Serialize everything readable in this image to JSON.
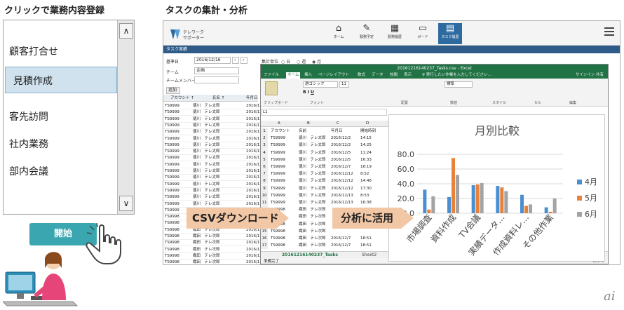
{
  "left": {
    "heading": "クリックで業務内容登録",
    "tasks": [
      "顧客打合せ",
      "見積作成",
      "客先訪問",
      "社内業務",
      "部内会議"
    ],
    "selected_index": 1,
    "scroll_up": "∧",
    "scroll_down": "∨",
    "start_button": "開始"
  },
  "right": {
    "heading": "タスクの集計・分析"
  },
  "app": {
    "logo_text": "テレワーク\nサポーター",
    "nav": [
      {
        "label": "ホーム",
        "icon": "home-icon"
      },
      {
        "label": "勤務予定",
        "icon": "edit-icon"
      },
      {
        "label": "勤務履歴",
        "icon": "calendar-icon"
      },
      {
        "label": "ボード",
        "icon": "monitor-icon"
      },
      {
        "label": "タスク履歴",
        "icon": "task-history-icon"
      }
    ],
    "subbar_title": "タスク実績",
    "filters": {
      "base_date_label": "基準日",
      "base_date_value": "2016/12/16",
      "period_label": "集計単位",
      "period_options": [
        "日",
        "週",
        "月"
      ],
      "team_label": "チーム",
      "team_value": "企画",
      "member_label": "チームメンバー",
      "add_button": "追加"
    },
    "list_headers": [
      "アカウント ↑",
      "氏名 ↑",
      "年月日"
    ],
    "list_rows": [
      [
        "TS9999",
        "徳川　テレ太郎",
        "2016/12"
      ],
      [
        "TS9999",
        "徳川　テレ太郎",
        "2016/12"
      ],
      [
        "TS9999",
        "徳川　テレ太郎",
        "2016/12"
      ],
      [
        "TS9999",
        "徳川　テレ太郎",
        "2016/12"
      ],
      [
        "TS9999",
        "徳川　テレ太郎",
        "2016/12"
      ],
      [
        "TS9999",
        "徳川　テレ太郎",
        "2016/12"
      ],
      [
        "TS9999",
        "徳川　テレ太郎",
        "2016/12"
      ],
      [
        "TS9999",
        "徳川　テレ太郎",
        "2016/12"
      ],
      [
        "TS9999",
        "徳川　テレ太郎",
        "2016/12"
      ],
      [
        "TS9999",
        "徳川　テレ太郎",
        "2016/12"
      ],
      [
        "TS9999",
        "徳川　テレ太郎",
        "2016/12"
      ],
      [
        "TS9999",
        "徳川　テレ太郎",
        "2016/12"
      ],
      [
        "TS9999",
        "徳川　テレ太郎",
        "2016/12"
      ],
      [
        "TS9999",
        "徳川　テレ太郎",
        "2016/12"
      ],
      [
        "TS9999",
        "徳川　テレ太郎",
        "2016/12"
      ],
      [
        "TS9999",
        "徳川　テレ太郎",
        "2016/12"
      ],
      [
        "TS9999",
        "徳川　テレ太郎",
        "2016/12"
      ],
      [
        "TS9998",
        "織田　テレ次郎",
        "2016/12"
      ],
      [
        "TS9998",
        "織田　テレ次郎",
        "2016/12"
      ],
      [
        "TS9998",
        "織田　テレ次郎",
        "2016/12"
      ],
      [
        "TS9998",
        "織田　テレ次郎",
        "2016/12"
      ],
      [
        "TS9998",
        "織田　テレ次郎",
        "2016/12"
      ],
      [
        "TS9998",
        "織田　テレ次郎",
        "2016/12"
      ],
      [
        "TS9998",
        "織田　テレ次郎",
        "2016/12"
      ],
      [
        "TS9998",
        "織田　テレ次郎",
        "2016/12"
      ]
    ]
  },
  "excel": {
    "title": "20161216140237_Tasks.csv - Excel",
    "tabs": [
      "ファイル",
      "ホーム",
      "挿入",
      "ページレイアウト",
      "数式",
      "データ",
      "校閲",
      "表示"
    ],
    "active_tab": "ホーム",
    "tell_me": "実行したい作業を入力してください...",
    "sign_in": "サインイン",
    "share": "共有",
    "ribbon_groups": [
      "クリップボード",
      "フォント",
      "配置",
      "数値",
      "スタイル",
      "セル",
      "編集"
    ],
    "font_name": "游ゴシック",
    "font_size": "11",
    "number_format": "標準",
    "cell_ref": "L1",
    "col_letters": [
      "A",
      "B",
      "C",
      "D"
    ],
    "rows": [
      [
        "1",
        "アカウント",
        "名前",
        "年月日",
        "開始時刻"
      ],
      [
        "2",
        "TS9999",
        "徳川　テレ太郎",
        "2016/12/2",
        "14:15"
      ],
      [
        "3",
        "TS9999",
        "徳川　テレ太郎",
        "2016/12/2",
        "14:25"
      ],
      [
        "4",
        "TS9999",
        "徳川　テレ太郎",
        "2016/12/5",
        "11:24"
      ],
      [
        "5",
        "TS9999",
        "徳川　テレ太郎",
        "2016/12/5",
        "16:33"
      ],
      [
        "6",
        "TS9999",
        "徳川　テレ太郎",
        "2016/12/7",
        "16:19"
      ],
      [
        "7",
        "TS9999",
        "徳川　テレ太郎",
        "2016/12/12",
        "8:52"
      ],
      [
        "8",
        "TS9999",
        "徳川　テレ太郎",
        "2016/12/12",
        "14:46"
      ],
      [
        "9",
        "TS9999",
        "徳川　テレ太郎",
        "2016/12/12",
        "17:30"
      ],
      [
        "10",
        "TS9999",
        "徳川　テレ太郎",
        "2016/12/13",
        "8:53"
      ],
      [
        "11",
        "TS9999",
        "徳川　テレ太郎",
        "2016/12/13",
        "16:38"
      ],
      [
        "12",
        "TS9998",
        "織田　テレ次郎",
        "",
        ""
      ],
      [
        "13",
        "TS9998",
        "織田　テレ次郎",
        "",
        ""
      ],
      [
        "14",
        "TS9998",
        "織田　テレ次郎",
        "",
        ""
      ],
      [
        "15",
        "TS9998",
        "織田　テレ次郎",
        "",
        ""
      ],
      [
        "16",
        "TS9998",
        "織田　テレ次郎",
        "2016/12/7",
        "18:51"
      ],
      [
        "17",
        "TS9998",
        "織田　テレ次郎",
        "2016/12/7",
        "18:51"
      ]
    ],
    "sheet_tabs": [
      "20161216140237_Tasks",
      "Sheet2",
      "201612"
    ],
    "status": "準備完了",
    "zoom": "100%"
  },
  "banners": {
    "csv": "CSVダウンロード",
    "analyze": "分析に活用"
  },
  "chart_data": {
    "type": "bar",
    "title": "月別比較",
    "categories": [
      "市場調査",
      "資料作成",
      "TV会議",
      "実績データ…",
      "作成資料レ…",
      "その他作業"
    ],
    "series": [
      {
        "name": "4月",
        "values": [
          32,
          22,
          38,
          37,
          25,
          8
        ],
        "color": "#4a8fd0"
      },
      {
        "name": "5月",
        "values": [
          5,
          75,
          39,
          35,
          10,
          2
        ],
        "color": "#e8823a"
      },
      {
        "name": "6月",
        "values": [
          23,
          52,
          41,
          30,
          12,
          20
        ],
        "color": "#a3a3a3"
      }
    ],
    "ylim": [
      0,
      80
    ],
    "yticks": [
      "0.0",
      "20.0",
      "40.0",
      "60.0",
      "80.0"
    ],
    "legend": "right",
    "grid": true
  },
  "watermark": "ai",
  "colors": {
    "teal": "#3aa7b0",
    "excel_green": "#217346",
    "banner": "#f2c7a6",
    "nav_active": "#2d6a9f"
  }
}
